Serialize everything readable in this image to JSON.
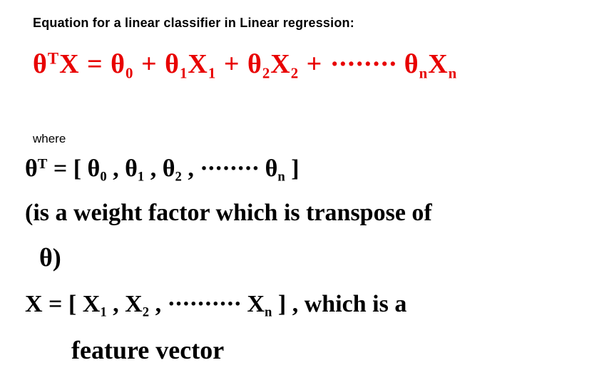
{
  "title": "Equation for a linear classifier in Linear regression:",
  "equation_html": "θ<sup>T</sup>X = θ<sub>0</sub> + θ<sub>1</sub>X<sub>1</sub> + θ<sub>2</sub>X<sub>2</sub> + <span class=\"dots\">········</span> θ<sub>n</sub>X<sub>n</sub>",
  "where_label": "where",
  "theta_t_html": "θ<sup>T</sup> = [ θ<sub>0</sub> , θ<sub>1</sub> , θ<sub>2</sub> , <span class=\"dots\">········</span> θ<sub>n</sub> ]",
  "weight_note_line1": "(is a weight factor which is transpose of",
  "weight_note_line2": "θ)",
  "x_def_html": "X = [ X<sub>1</sub> , X<sub>2</sub> , <span class=\"dots\">··········</span> X<sub>n</sub> ] , which is a",
  "x_def_line2": "feature vector",
  "chart_data": {
    "type": "table",
    "title": "Linear classifier / linear regression equation with definitions",
    "equations": [
      {
        "label": "main",
        "latex": "\\theta^T X = \\theta_0 + \\theta_1 X_1 + \\theta_2 X_2 + \\cdots + \\theta_n X_n",
        "color": "#e80000"
      },
      {
        "label": "theta_transpose",
        "latex": "\\theta^T = [\\theta_0, \\theta_1, \\theta_2, \\ldots, \\theta_n]",
        "description": "is a weight factor which is transpose of θ"
      },
      {
        "label": "x_vector",
        "latex": "X = [X_1, X_2, \\ldots, X_n]",
        "description": "which is a feature vector"
      }
    ]
  }
}
